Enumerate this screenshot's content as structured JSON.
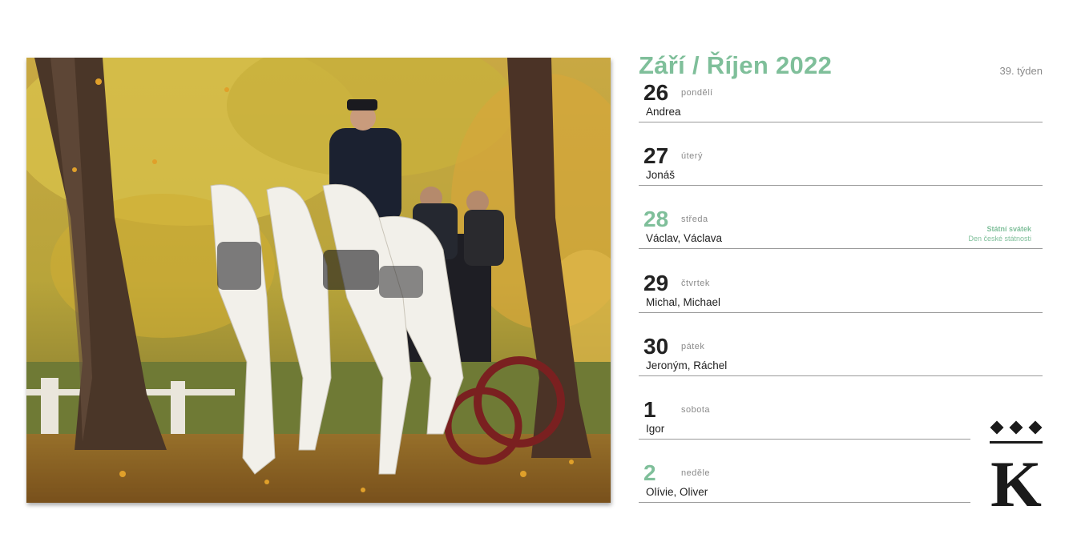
{
  "header": {
    "title": "Září / Říjen 2022",
    "week": "39. týden"
  },
  "days": [
    {
      "number": "26",
      "weekday": "pondělí",
      "names": "Andrea"
    },
    {
      "number": "27",
      "weekday": "úterý",
      "names": "Jonáš"
    },
    {
      "number": "28",
      "weekday": "středa",
      "names": "Václav, Václava",
      "holiday_title": "Státní svátek",
      "holiday_name": "Den české státnosti"
    },
    {
      "number": "29",
      "weekday": "čtvrtek",
      "names": "Michal, Michael"
    },
    {
      "number": "30",
      "weekday": "pátek",
      "names": "Jeroným, Ráchel"
    },
    {
      "number": "1",
      "weekday": "sobota",
      "names": "Igor"
    },
    {
      "number": "2",
      "weekday": "neděle",
      "names": "Olívie, Oliver"
    }
  ],
  "colors": {
    "accent": "#7fbf9a",
    "text": "#222222",
    "muted": "#8a8a8a"
  },
  "logo": {
    "letter": "K"
  }
}
